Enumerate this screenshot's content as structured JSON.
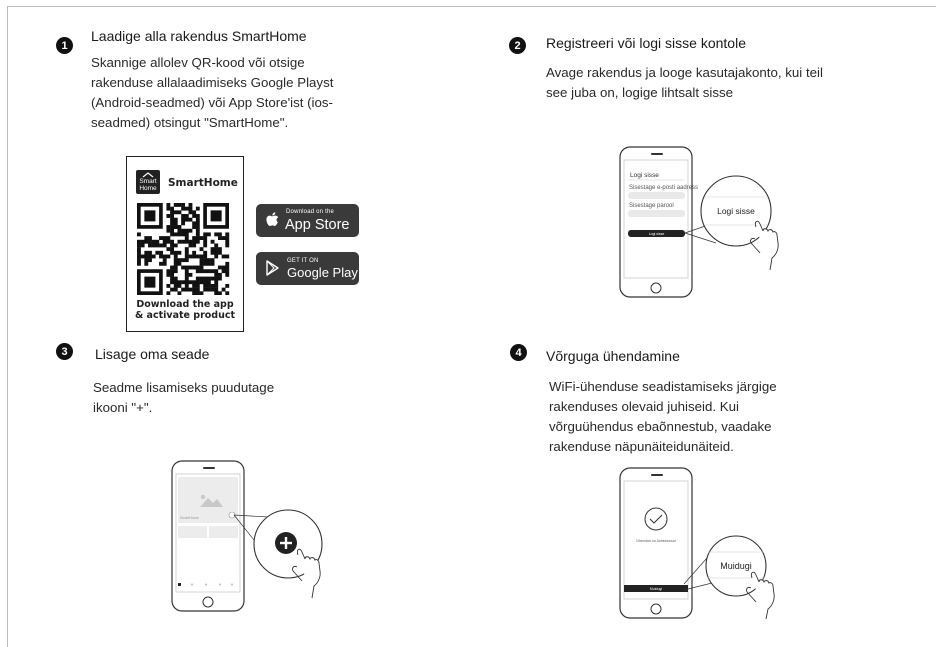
{
  "steps": [
    {
      "number": "1",
      "title": "Laadige alla rakendus SmartHome",
      "text": "Skannige allolev QR-kood või otsige\nrakenduse allalaadimiseks Google Playst\n(Android-seadmed) või App Store'ist (ios-\nseadmed) otsingut \"SmartHome\"."
    },
    {
      "number": "2",
      "title": "Registreeri või logi sisse kontole",
      "text": "Avage rakendus ja looge kasutajakonto, kui teil\nsee juba on, logige lihtsalt sisse"
    },
    {
      "number": "3",
      "title": "Lisage oma seade",
      "text": "Seadme lisamiseks puudutage\nikooni  \"+\"."
    },
    {
      "number": "4",
      "title": "Võrguga ühendamine",
      "text": "WiFi-ühenduse seadistamiseks järgige\nrakenduses olevaid juhiseid. Kui\nvõrguühendus ebaõnnestub, vaadake\nrakenduse näpunäiteidunäiteid."
    }
  ],
  "qr_card": {
    "logo_text": "Smart\nHome",
    "brand": "SmartHome",
    "caption": "Download the app\n& activate product"
  },
  "app_store": {
    "small": "Download on the",
    "big": "App Store"
  },
  "google_play": {
    "small": "GET IT ON",
    "big": "Google Play"
  },
  "phone_login": {
    "title": "Logi sisse",
    "field1": "Sisestage e-posti aadress",
    "field2": "Sisestage parool",
    "button": "Logi sisse",
    "callout": "Logi sisse"
  },
  "phone_add": {
    "device_label": "SmartHome",
    "callout_icon": "plus-icon"
  },
  "phone_connect": {
    "status": "Ühendus on õnnestunud",
    "button": "Muidugi",
    "callout": "Muidugi"
  }
}
